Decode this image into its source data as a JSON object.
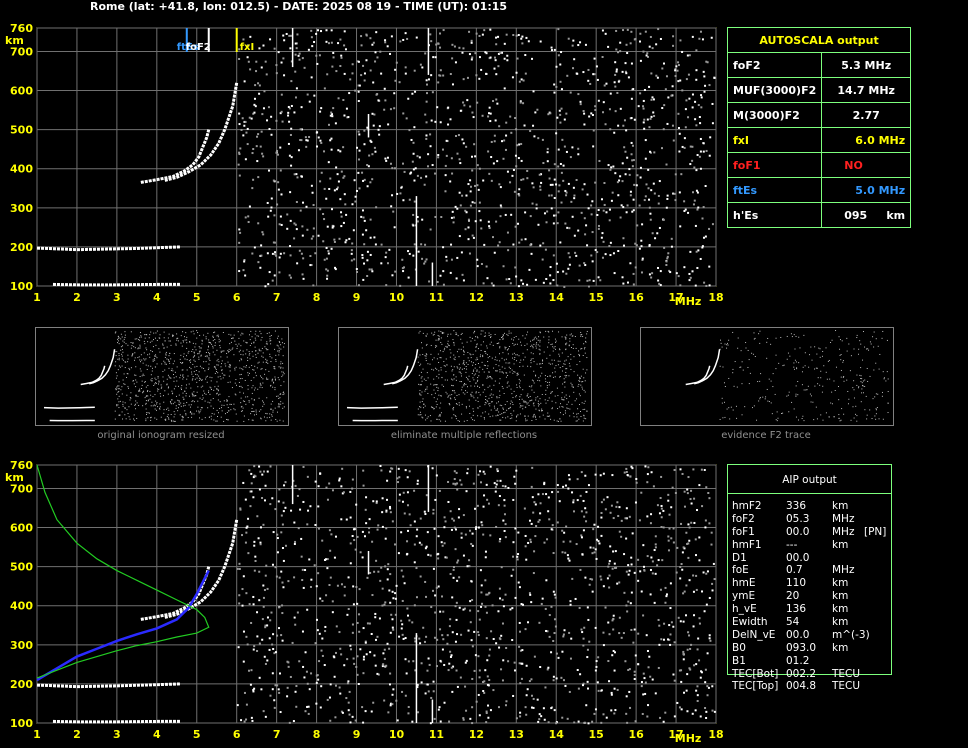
{
  "header": {
    "title": "Rome (lat: +41.8, lon: 012.5) - DATE: 2025 08 19 - TIME (UT): 01:15"
  },
  "chart_data": [
    {
      "type": "scatter",
      "title": "",
      "xlabel": "MHz",
      "ylabel": "km",
      "xlim": [
        1,
        18
      ],
      "ylim": [
        100,
        760
      ],
      "x_ticks": [
        "1",
        "2",
        "3",
        "4",
        "5",
        "6",
        "7",
        "8",
        "9",
        "10",
        "11",
        "12",
        "13",
        "14",
        "15",
        "16",
        "17",
        "18"
      ],
      "y_ticks": [
        "100",
        "200",
        "300",
        "400",
        "500",
        "600",
        "700",
        "760"
      ],
      "markers": [
        {
          "label": "ftEs",
          "x": 4.75,
          "color": "#3399ff"
        },
        {
          "label": "foF2",
          "x": 5.3,
          "color": "#ffffff"
        },
        {
          "label": "fxI",
          "x": 6.0,
          "color": "#ffff00"
        }
      ],
      "traces": [
        {
          "name": "",
          "points": [
            [
              1,
              197
            ],
            [
              1.5,
              195
            ],
            [
              2,
              193
            ],
            [
              2.5,
              194
            ],
            [
              3,
              195
            ],
            [
              3.5,
              196
            ],
            [
              4,
              198
            ],
            [
              4.6,
              200
            ]
          ]
        },
        {
          "name": "",
          "points": [
            [
              1.4,
              104
            ],
            [
              2,
              103
            ],
            [
              3,
              103
            ],
            [
              4,
              104
            ],
            [
              4.6,
              104
            ]
          ]
        },
        {
          "name": "",
          "points": [
            [
              3.6,
              365
            ],
            [
              4,
              372
            ],
            [
              4.4,
              380
            ],
            [
              4.7,
              395
            ],
            [
              4.9,
              410
            ],
            [
              5.05,
              430
            ],
            [
              5.15,
              455
            ],
            [
              5.25,
              480
            ],
            [
              5.3,
              500
            ]
          ]
        },
        {
          "name": "",
          "points": [
            [
              4.2,
              370
            ],
            [
              4.5,
              378
            ],
            [
              4.8,
              392
            ],
            [
              5.1,
              410
            ],
            [
              5.35,
              435
            ],
            [
              5.55,
              465
            ],
            [
              5.7,
              500
            ],
            [
              5.8,
              530
            ],
            [
              5.9,
              560
            ],
            [
              5.95,
              590
            ],
            [
              6.0,
              620
            ]
          ]
        }
      ]
    },
    {
      "type": "line",
      "title": "",
      "xlabel": "MHz",
      "ylabel": "km",
      "xlim": [
        1,
        18
      ],
      "ylim": [
        100,
        760
      ],
      "x_ticks": [
        "1",
        "2",
        "3",
        "4",
        "5",
        "6",
        "7",
        "8",
        "9",
        "10",
        "11",
        "12",
        "13",
        "14",
        "15",
        "16",
        "17",
        "18"
      ],
      "y_ticks": [
        "100",
        "200",
        "300",
        "400",
        "500",
        "600",
        "700",
        "760"
      ],
      "series": [
        {
          "name": "",
          "color": "#2a2aff",
          "points": [
            [
              1,
              210
            ],
            [
              1.5,
              240
            ],
            [
              2,
              270
            ],
            [
              2.5,
              290
            ],
            [
              3,
              310
            ],
            [
              3.5,
              327
            ],
            [
              4,
              342
            ],
            [
              4.5,
              365
            ],
            [
              4.8,
              395
            ],
            [
              5.0,
              430
            ],
            [
              5.2,
              470
            ],
            [
              5.3,
              490
            ]
          ]
        },
        {
          "name": "",
          "color": "#22cc22",
          "points": [
            [
              1,
              760
            ],
            [
              1.2,
              690
            ],
            [
              1.5,
              620
            ],
            [
              2,
              560
            ],
            [
              2.5,
              520
            ],
            [
              3,
              490
            ],
            [
              3.5,
              465
            ],
            [
              4,
              440
            ],
            [
              4.5,
              415
            ],
            [
              5.0,
              390
            ],
            [
              5.2,
              370
            ],
            [
              5.3,
              345
            ],
            [
              5.0,
              330
            ],
            [
              4.5,
              320
            ],
            [
              4,
              308
            ],
            [
              3.5,
              298
            ],
            [
              3,
              285
            ],
            [
              2.5,
              270
            ],
            [
              2,
              255
            ],
            [
              1.5,
              235
            ],
            [
              1,
              215
            ]
          ]
        }
      ],
      "traces": [
        {
          "name": "",
          "points": [
            [
              1,
              197
            ],
            [
              2,
              193
            ],
            [
              3,
              195
            ],
            [
              4,
              198
            ],
            [
              4.6,
              200
            ]
          ]
        },
        {
          "name": "",
          "points": [
            [
              1.4,
              104
            ],
            [
              2,
              103
            ],
            [
              3,
              103
            ],
            [
              4,
              104
            ],
            [
              4.6,
              104
            ]
          ]
        },
        {
          "name": "",
          "points": [
            [
              3.6,
              365
            ],
            [
              4,
              372
            ],
            [
              4.4,
              380
            ],
            [
              4.7,
              395
            ],
            [
              4.9,
              410
            ],
            [
              5.05,
              430
            ],
            [
              5.15,
              455
            ],
            [
              5.25,
              480
            ],
            [
              5.3,
              500
            ]
          ]
        },
        {
          "name": "",
          "points": [
            [
              4.2,
              370
            ],
            [
              4.5,
              378
            ],
            [
              4.8,
              392
            ],
            [
              5.1,
              410
            ],
            [
              5.35,
              435
            ],
            [
              5.55,
              465
            ],
            [
              5.7,
              500
            ],
            [
              5.8,
              530
            ],
            [
              5.9,
              560
            ],
            [
              5.95,
              590
            ],
            [
              6.0,
              620
            ]
          ]
        }
      ]
    }
  ],
  "autoscala": {
    "title": "AUTOSCALA output",
    "rows": [
      {
        "label": "foF2",
        "value": "5.3 MHz",
        "color": "#ffffff"
      },
      {
        "label": "MUF(3000)F2",
        "value": "14.7 MHz",
        "color": "#ffffff"
      },
      {
        "label": "M(3000)F2",
        "value": "2.77",
        "color": "#ffffff"
      },
      {
        "label": "fxI",
        "value": "6.0 MHz",
        "color": "#ffff00"
      },
      {
        "label": "foF1",
        "value": "NO",
        "color": "#ff2020"
      },
      {
        "label": "ftEs",
        "value": "5.0 MHz",
        "color": "#3399ff"
      },
      {
        "label": "h'Es",
        "value": "095     km",
        "color": "#ffffff"
      }
    ]
  },
  "thumbnails": [
    {
      "caption": "original ionogram resized"
    },
    {
      "caption": "eliminate multiple reflections"
    },
    {
      "caption": "evidence F2 trace"
    }
  ],
  "aip": {
    "title": "AIP output",
    "rows": [
      {
        "name": "hmF2",
        "value": "336",
        "unit": "km",
        "extra": ""
      },
      {
        "name": "foF2",
        "value": "05.3",
        "unit": "MHz",
        "extra": ""
      },
      {
        "name": "foF1",
        "value": "00.0",
        "unit": "MHz",
        "extra": "[PN]"
      },
      {
        "name": "hmF1",
        "value": "---",
        "unit": "km",
        "extra": ""
      },
      {
        "name": "D1",
        "value": "00.0",
        "unit": "",
        "extra": ""
      },
      {
        "name": "foE",
        "value": "0.7",
        "unit": "MHz",
        "extra": ""
      },
      {
        "name": "hmE",
        "value": "110",
        "unit": "km",
        "extra": ""
      },
      {
        "name": "ymE",
        "value": "20",
        "unit": "km",
        "extra": ""
      },
      {
        "name": "h_vE",
        "value": "136",
        "unit": "km",
        "extra": ""
      },
      {
        "name": "Ewidth",
        "value": "54",
        "unit": "km",
        "extra": ""
      },
      {
        "name": "DelN_vE",
        "value": "00.0",
        "unit": "m^(-3)",
        "extra": ""
      },
      {
        "name": "B0",
        "value": "093.0",
        "unit": "km",
        "extra": ""
      },
      {
        "name": "B1",
        "value": "01.2",
        "unit": "",
        "extra": ""
      },
      {
        "name": "TEC[Bot]",
        "value": "002.2",
        "unit": "TECU",
        "extra": ""
      },
      {
        "name": "TEC[Top]",
        "value": "004.8",
        "unit": "TECU",
        "extra": ""
      }
    ]
  }
}
